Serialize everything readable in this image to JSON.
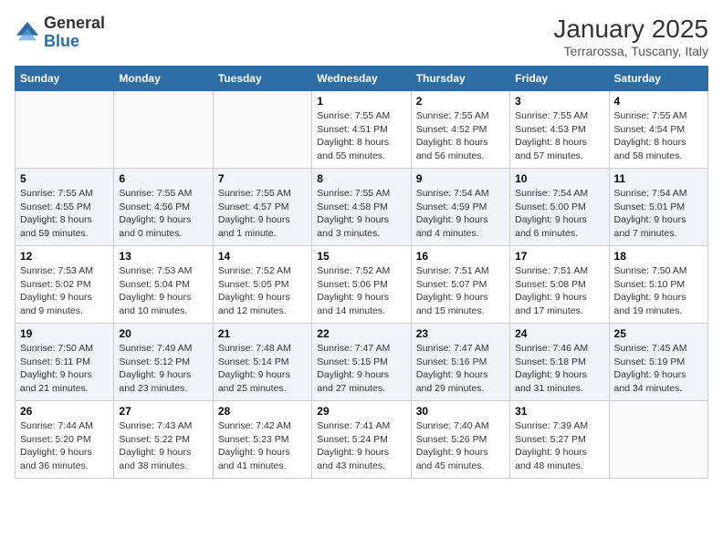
{
  "header": {
    "logo_line1": "General",
    "logo_line2": "Blue",
    "month": "January 2025",
    "location": "Terrarossa, Tuscany, Italy"
  },
  "weekdays": [
    "Sunday",
    "Monday",
    "Tuesday",
    "Wednesday",
    "Thursday",
    "Friday",
    "Saturday"
  ],
  "weeks": [
    [
      {
        "day": "",
        "info": ""
      },
      {
        "day": "",
        "info": ""
      },
      {
        "day": "",
        "info": ""
      },
      {
        "day": "1",
        "info": "Sunrise: 7:55 AM\nSunset: 4:51 PM\nDaylight: 8 hours\nand 55 minutes."
      },
      {
        "day": "2",
        "info": "Sunrise: 7:55 AM\nSunset: 4:52 PM\nDaylight: 8 hours\nand 56 minutes."
      },
      {
        "day": "3",
        "info": "Sunrise: 7:55 AM\nSunset: 4:53 PM\nDaylight: 8 hours\nand 57 minutes."
      },
      {
        "day": "4",
        "info": "Sunrise: 7:55 AM\nSunset: 4:54 PM\nDaylight: 8 hours\nand 58 minutes."
      }
    ],
    [
      {
        "day": "5",
        "info": "Sunrise: 7:55 AM\nSunset: 4:55 PM\nDaylight: 8 hours\nand 59 minutes."
      },
      {
        "day": "6",
        "info": "Sunrise: 7:55 AM\nSunset: 4:56 PM\nDaylight: 9 hours\nand 0 minutes."
      },
      {
        "day": "7",
        "info": "Sunrise: 7:55 AM\nSunset: 4:57 PM\nDaylight: 9 hours\nand 1 minute."
      },
      {
        "day": "8",
        "info": "Sunrise: 7:55 AM\nSunset: 4:58 PM\nDaylight: 9 hours\nand 3 minutes."
      },
      {
        "day": "9",
        "info": "Sunrise: 7:54 AM\nSunset: 4:59 PM\nDaylight: 9 hours\nand 4 minutes."
      },
      {
        "day": "10",
        "info": "Sunrise: 7:54 AM\nSunset: 5:00 PM\nDaylight: 9 hours\nand 6 minutes."
      },
      {
        "day": "11",
        "info": "Sunrise: 7:54 AM\nSunset: 5:01 PM\nDaylight: 9 hours\nand 7 minutes."
      }
    ],
    [
      {
        "day": "12",
        "info": "Sunrise: 7:53 AM\nSunset: 5:02 PM\nDaylight: 9 hours\nand 9 minutes."
      },
      {
        "day": "13",
        "info": "Sunrise: 7:53 AM\nSunset: 5:04 PM\nDaylight: 9 hours\nand 10 minutes."
      },
      {
        "day": "14",
        "info": "Sunrise: 7:52 AM\nSunset: 5:05 PM\nDaylight: 9 hours\nand 12 minutes."
      },
      {
        "day": "15",
        "info": "Sunrise: 7:52 AM\nSunset: 5:06 PM\nDaylight: 9 hours\nand 14 minutes."
      },
      {
        "day": "16",
        "info": "Sunrise: 7:51 AM\nSunset: 5:07 PM\nDaylight: 9 hours\nand 15 minutes."
      },
      {
        "day": "17",
        "info": "Sunrise: 7:51 AM\nSunset: 5:08 PM\nDaylight: 9 hours\nand 17 minutes."
      },
      {
        "day": "18",
        "info": "Sunrise: 7:50 AM\nSunset: 5:10 PM\nDaylight: 9 hours\nand 19 minutes."
      }
    ],
    [
      {
        "day": "19",
        "info": "Sunrise: 7:50 AM\nSunset: 5:11 PM\nDaylight: 9 hours\nand 21 minutes."
      },
      {
        "day": "20",
        "info": "Sunrise: 7:49 AM\nSunset: 5:12 PM\nDaylight: 9 hours\nand 23 minutes."
      },
      {
        "day": "21",
        "info": "Sunrise: 7:48 AM\nSunset: 5:14 PM\nDaylight: 9 hours\nand 25 minutes."
      },
      {
        "day": "22",
        "info": "Sunrise: 7:47 AM\nSunset: 5:15 PM\nDaylight: 9 hours\nand 27 minutes."
      },
      {
        "day": "23",
        "info": "Sunrise: 7:47 AM\nSunset: 5:16 PM\nDaylight: 9 hours\nand 29 minutes."
      },
      {
        "day": "24",
        "info": "Sunrise: 7:46 AM\nSunset: 5:18 PM\nDaylight: 9 hours\nand 31 minutes."
      },
      {
        "day": "25",
        "info": "Sunrise: 7:45 AM\nSunset: 5:19 PM\nDaylight: 9 hours\nand 34 minutes."
      }
    ],
    [
      {
        "day": "26",
        "info": "Sunrise: 7:44 AM\nSunset: 5:20 PM\nDaylight: 9 hours\nand 36 minutes."
      },
      {
        "day": "27",
        "info": "Sunrise: 7:43 AM\nSunset: 5:22 PM\nDaylight: 9 hours\nand 38 minutes."
      },
      {
        "day": "28",
        "info": "Sunrise: 7:42 AM\nSunset: 5:23 PM\nDaylight: 9 hours\nand 41 minutes."
      },
      {
        "day": "29",
        "info": "Sunrise: 7:41 AM\nSunset: 5:24 PM\nDaylight: 9 hours\nand 43 minutes."
      },
      {
        "day": "30",
        "info": "Sunrise: 7:40 AM\nSunset: 5:26 PM\nDaylight: 9 hours\nand 45 minutes."
      },
      {
        "day": "31",
        "info": "Sunrise: 7:39 AM\nSunset: 5:27 PM\nDaylight: 9 hours\nand 48 minutes."
      },
      {
        "day": "",
        "info": ""
      }
    ]
  ]
}
